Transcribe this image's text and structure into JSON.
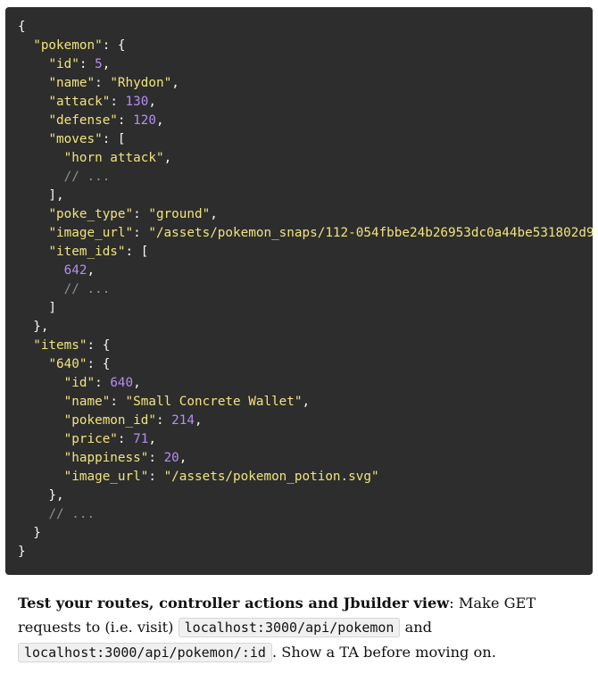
{
  "code": {
    "lines": [
      [
        [
          "p",
          "{"
        ]
      ],
      [
        [
          "p",
          "  "
        ],
        [
          "k",
          "\"pokemon\""
        ],
        [
          "p",
          ": {"
        ]
      ],
      [
        [
          "p",
          "    "
        ],
        [
          "k",
          "\"id\""
        ],
        [
          "p",
          ": "
        ],
        [
          "n",
          "5"
        ],
        [
          "p",
          ","
        ]
      ],
      [
        [
          "p",
          "    "
        ],
        [
          "k",
          "\"name\""
        ],
        [
          "p",
          ": "
        ],
        [
          "s",
          "\"Rhydon\""
        ],
        [
          "p",
          ","
        ]
      ],
      [
        [
          "p",
          "    "
        ],
        [
          "k",
          "\"attack\""
        ],
        [
          "p",
          ": "
        ],
        [
          "n",
          "130"
        ],
        [
          "p",
          ","
        ]
      ],
      [
        [
          "p",
          "    "
        ],
        [
          "k",
          "\"defense\""
        ],
        [
          "p",
          ": "
        ],
        [
          "n",
          "120"
        ],
        [
          "p",
          ","
        ]
      ],
      [
        [
          "p",
          "    "
        ],
        [
          "k",
          "\"moves\""
        ],
        [
          "p",
          ": ["
        ]
      ],
      [
        [
          "p",
          "      "
        ],
        [
          "s",
          "\"horn attack\""
        ],
        [
          "p",
          ","
        ]
      ],
      [
        [
          "p",
          "      "
        ],
        [
          "c",
          "// ..."
        ]
      ],
      [
        [
          "p",
          "    ],"
        ]
      ],
      [
        [
          "p",
          "    "
        ],
        [
          "k",
          "\"poke_type\""
        ],
        [
          "p",
          ": "
        ],
        [
          "s",
          "\"ground\""
        ],
        [
          "p",
          ","
        ]
      ],
      [
        [
          "p",
          "    "
        ],
        [
          "k",
          "\"image_url\""
        ],
        [
          "p",
          ": "
        ],
        [
          "s",
          "\"/assets/pokemon_snaps/112-054fbbe24b26953dc0a44be531802d9"
        ]
      ],
      [
        [
          "p",
          "    "
        ],
        [
          "k",
          "\"item_ids\""
        ],
        [
          "p",
          ": ["
        ]
      ],
      [
        [
          "p",
          "      "
        ],
        [
          "n",
          "642"
        ],
        [
          "p",
          ","
        ]
      ],
      [
        [
          "p",
          "      "
        ],
        [
          "c",
          "// ..."
        ]
      ],
      [
        [
          "p",
          "    ]"
        ]
      ],
      [
        [
          "p",
          "  },"
        ]
      ],
      [
        [
          "p",
          "  "
        ],
        [
          "k",
          "\"items\""
        ],
        [
          "p",
          ": {"
        ]
      ],
      [
        [
          "p",
          "    "
        ],
        [
          "k",
          "\"640\""
        ],
        [
          "p",
          ": {"
        ]
      ],
      [
        [
          "p",
          "      "
        ],
        [
          "k",
          "\"id\""
        ],
        [
          "p",
          ": "
        ],
        [
          "n",
          "640"
        ],
        [
          "p",
          ","
        ]
      ],
      [
        [
          "p",
          "      "
        ],
        [
          "k",
          "\"name\""
        ],
        [
          "p",
          ": "
        ],
        [
          "s",
          "\"Small Concrete Wallet\""
        ],
        [
          "p",
          ","
        ]
      ],
      [
        [
          "p",
          "      "
        ],
        [
          "k",
          "\"pokemon_id\""
        ],
        [
          "p",
          ": "
        ],
        [
          "n",
          "214"
        ],
        [
          "p",
          ","
        ]
      ],
      [
        [
          "p",
          "      "
        ],
        [
          "k",
          "\"price\""
        ],
        [
          "p",
          ": "
        ],
        [
          "n",
          "71"
        ],
        [
          "p",
          ","
        ]
      ],
      [
        [
          "p",
          "      "
        ],
        [
          "k",
          "\"happiness\""
        ],
        [
          "p",
          ": "
        ],
        [
          "n",
          "20"
        ],
        [
          "p",
          ","
        ]
      ],
      [
        [
          "p",
          "      "
        ],
        [
          "k",
          "\"image_url\""
        ],
        [
          "p",
          ": "
        ],
        [
          "s",
          "\"/assets/pokemon_potion.svg\""
        ]
      ],
      [
        [
          "p",
          "    },"
        ]
      ],
      [
        [
          "p",
          "    "
        ],
        [
          "c",
          "// ..."
        ]
      ],
      [
        [
          "p",
          "  }"
        ]
      ],
      [
        [
          "p",
          "}"
        ]
      ]
    ]
  },
  "instructions": {
    "bold_lead": "Test your routes, controller actions and Jbuilder view",
    "text1": ": Make GET requests to (i.e. visit) ",
    "code1": "localhost:3000/api/pokemon",
    "text2": " and ",
    "code2": "localhost:3000/api/pokemon/:id",
    "text3": ". Show a TA before moving on."
  },
  "colors": {
    "code_background": "#2d2d2d",
    "keys_and_strings": "#f1e37d",
    "numbers": "#b58ef0",
    "comments": "#8a8f98",
    "punctuation": "#f8f8f2"
  }
}
